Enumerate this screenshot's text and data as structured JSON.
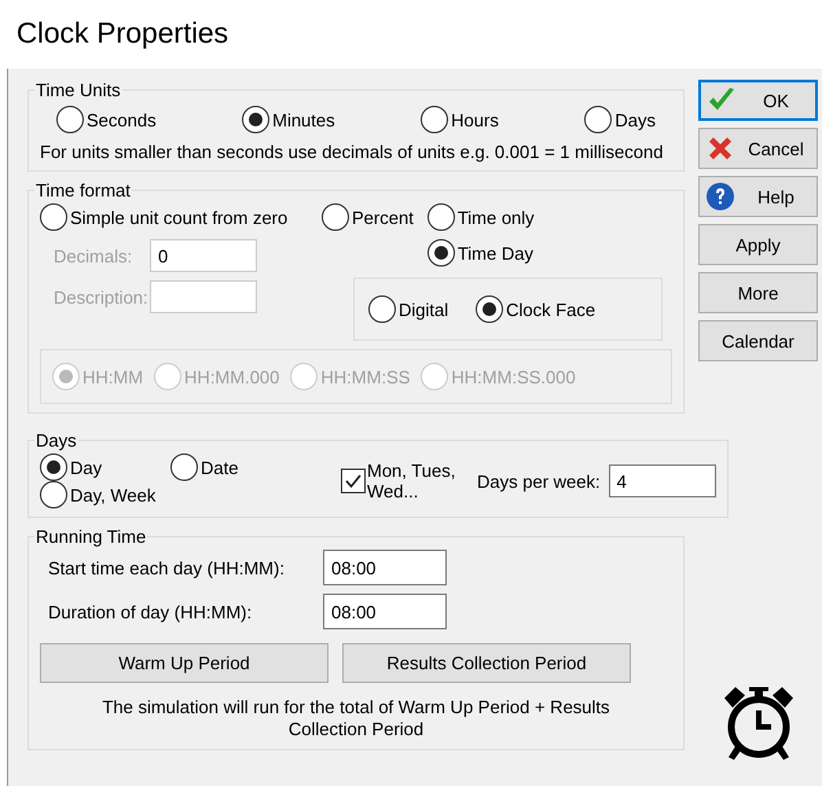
{
  "window": {
    "title": "Clock Properties"
  },
  "time_units": {
    "title": "Time Units",
    "options": [
      {
        "label": "Seconds",
        "selected": false
      },
      {
        "label": "Minutes",
        "selected": true
      },
      {
        "label": "Hours",
        "selected": false
      },
      {
        "label": "Days",
        "selected": false
      }
    ],
    "note": "For units smaller than seconds use decimals of units e.g. 0.001 = 1 millisecond"
  },
  "time_format": {
    "title": "Time format",
    "modes": [
      {
        "label": "Simple unit count from zero",
        "selected": false
      },
      {
        "label": "Percent",
        "selected": false
      },
      {
        "label": "Time only",
        "selected": false
      },
      {
        "label": "Time  Day",
        "selected": true
      }
    ],
    "decimals": {
      "label": "Decimals:",
      "value": "0",
      "disabled": true
    },
    "description": {
      "label": "Description:",
      "disabled": true
    },
    "display": [
      {
        "label": "Digital",
        "selected": false
      },
      {
        "label": "Clock Face",
        "selected": true
      }
    ],
    "formats": {
      "disabled": true,
      "options": [
        {
          "label": "HH:MM",
          "selected": true
        },
        {
          "label": "HH:MM.000",
          "selected": false
        },
        {
          "label": "HH:MM:SS",
          "selected": false
        },
        {
          "label": "HH:MM:SS.000",
          "selected": false
        }
      ]
    }
  },
  "days": {
    "title": "Days",
    "options": [
      {
        "label": "Day",
        "selected": true
      },
      {
        "label": "Date",
        "selected": false
      },
      {
        "label": "Day, Week",
        "selected": false
      }
    ],
    "weekday_names": {
      "label": "Mon, Tues, Wed...",
      "checked": true
    },
    "days_per_week": {
      "label": "Days per week:",
      "value": "4"
    }
  },
  "running_time": {
    "title": "Running Time",
    "start": {
      "label": "Start time each day (HH:MM):",
      "value": "08:00"
    },
    "duration": {
      "label": "Duration of day (HH:MM):",
      "value": "08:00"
    },
    "buttons": [
      "Warm Up Period",
      "Results Collection Period"
    ],
    "note": "The simulation will run for the total of Warm Up Period + Results Collection Period"
  },
  "buttons": [
    {
      "label": "OK",
      "kind": "check",
      "default": true
    },
    {
      "label": "Cancel",
      "kind": "cross",
      "default": false
    },
    {
      "label": "Help",
      "kind": "help",
      "default": false
    },
    {
      "label": "Apply",
      "kind": "plain",
      "default": false
    },
    {
      "label": "More",
      "kind": "plain",
      "default": false
    },
    {
      "label": "Calendar",
      "kind": "plain",
      "default": false
    }
  ]
}
